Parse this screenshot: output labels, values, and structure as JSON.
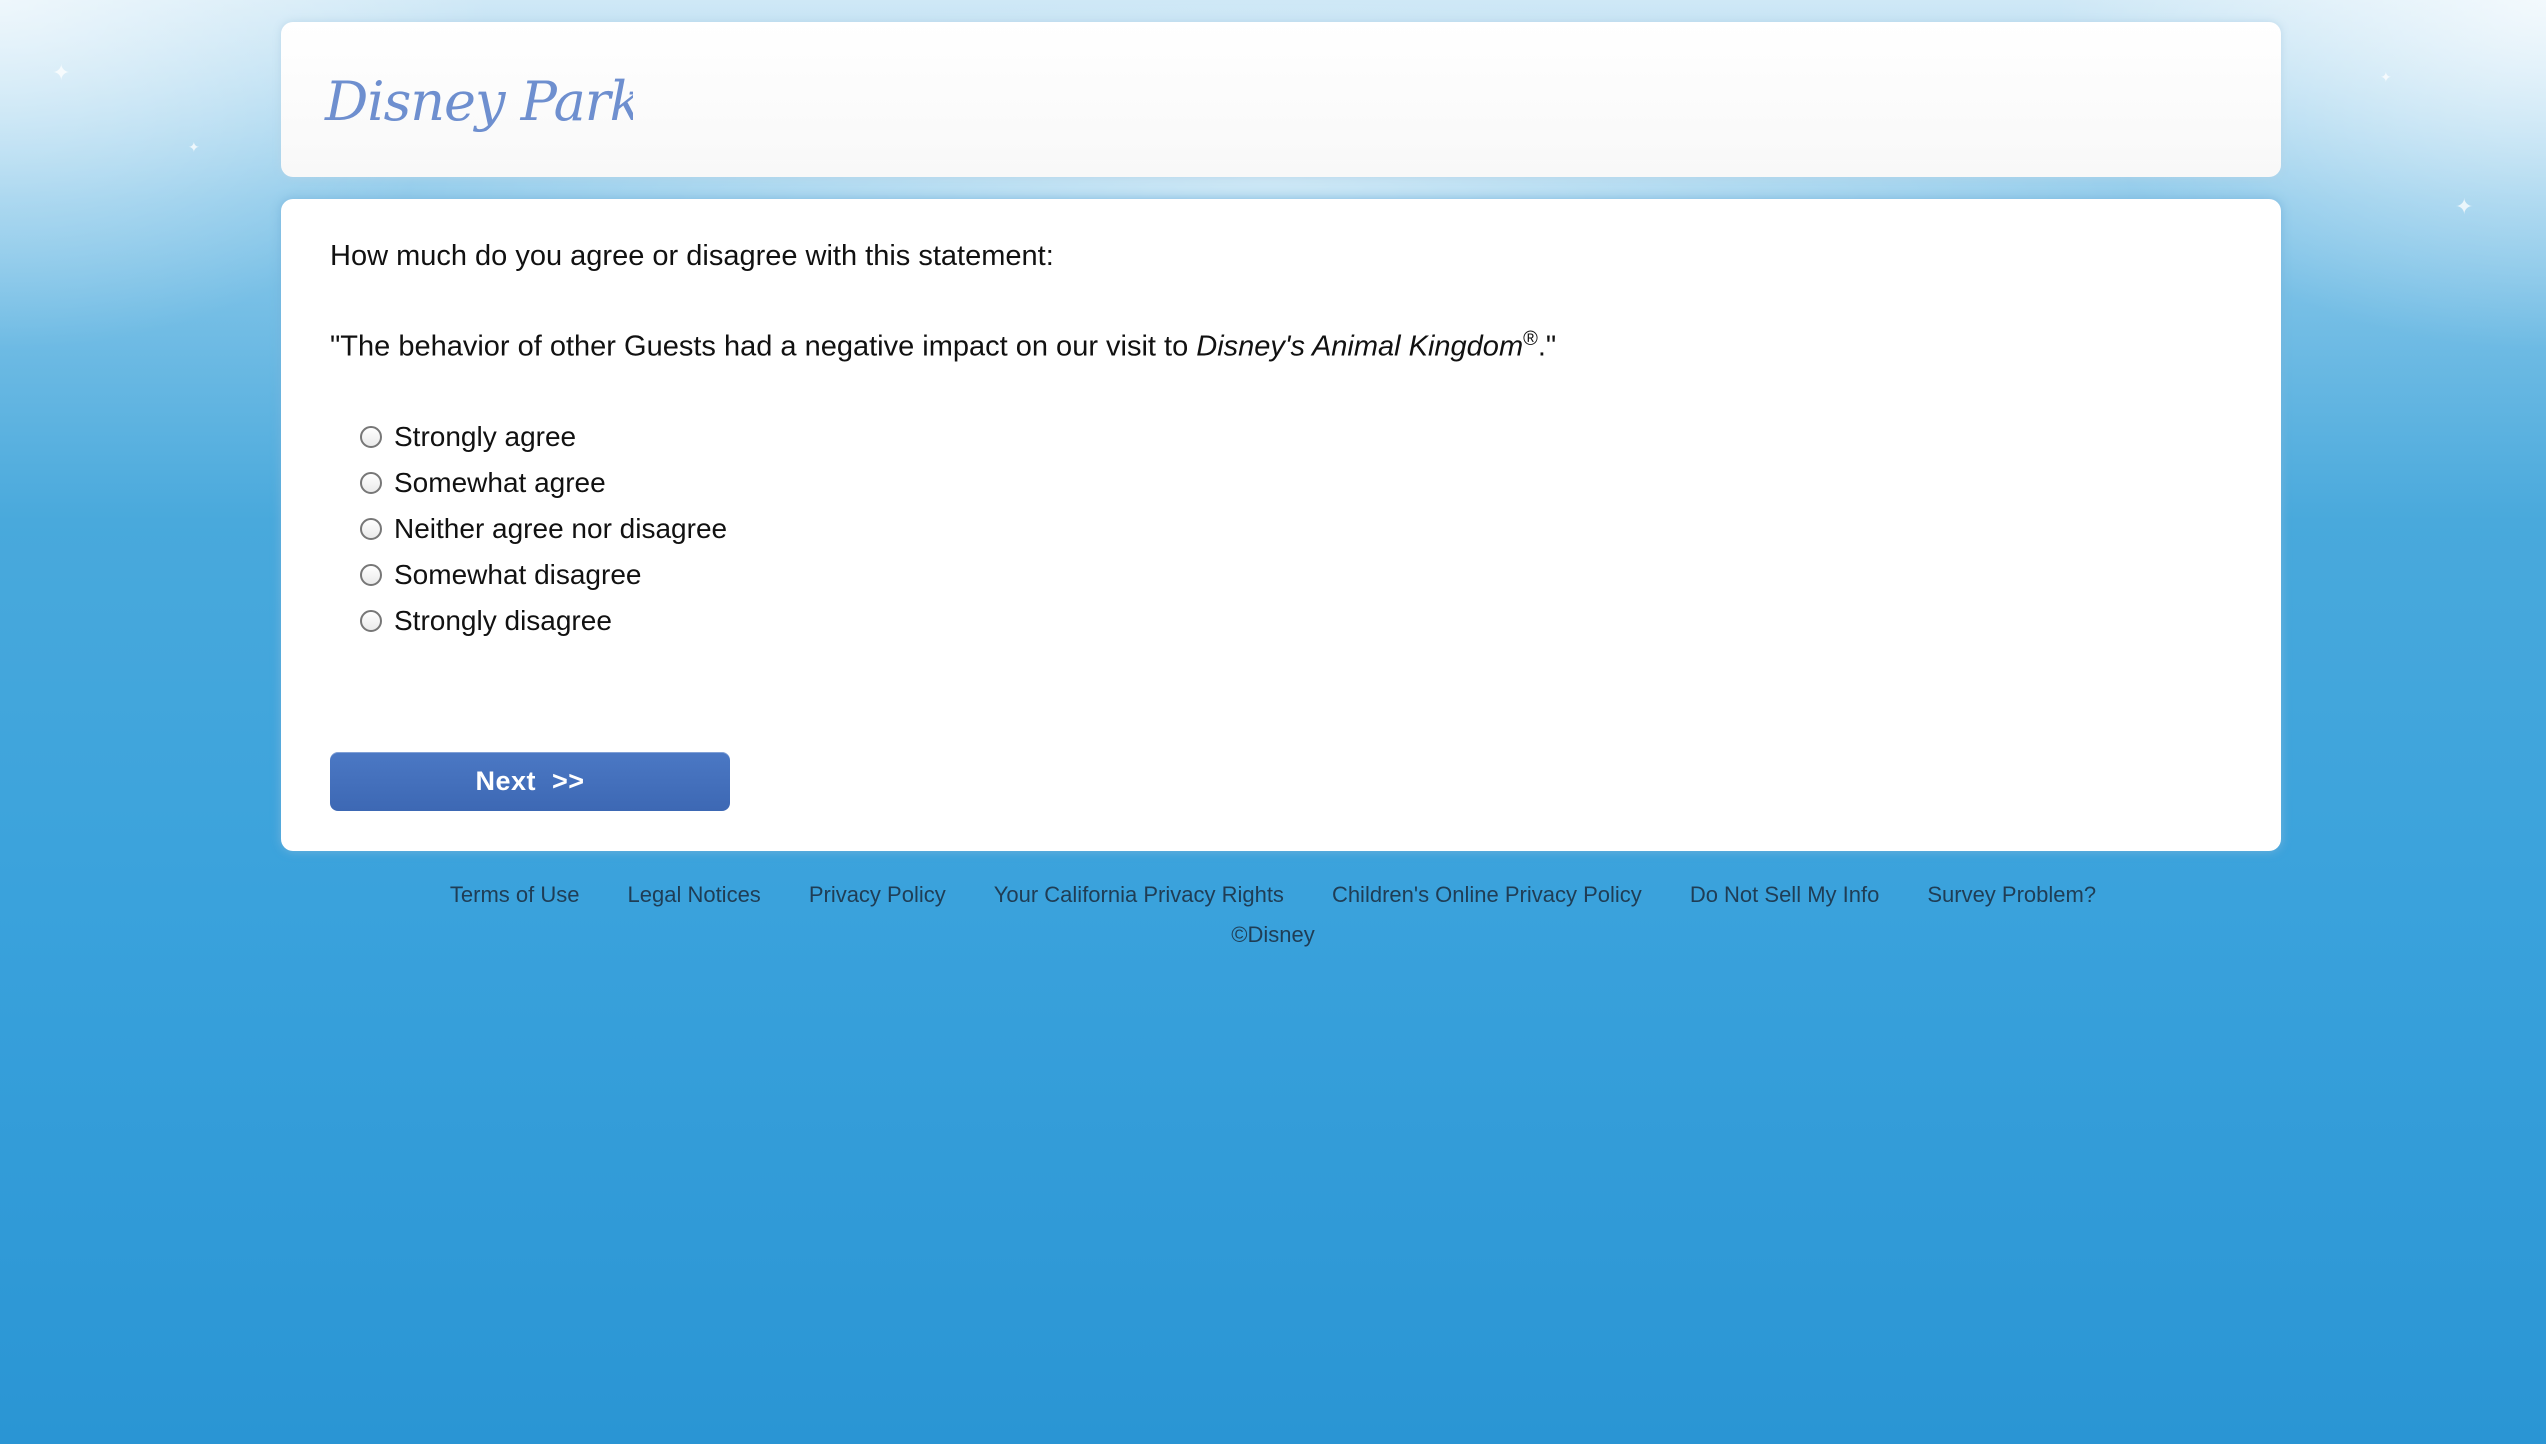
{
  "header": {
    "logo_text": "Disney Parks"
  },
  "survey": {
    "question": "How much do you agree or disagree with this statement:",
    "statement_prefix": "\"The behavior of other Guests had a negative impact on our visit to ",
    "statement_emphasis": "Disney's Animal Kingdom",
    "statement_mark": "®",
    "statement_suffix": ".\"",
    "options": [
      "Strongly agree",
      "Somewhat agree",
      "Neither agree nor disagree",
      "Somewhat disagree",
      "Strongly disagree"
    ],
    "next_label": "Next  >>"
  },
  "footer": {
    "links": [
      "Terms of Use",
      "Legal Notices",
      "Privacy Policy",
      "Your California Privacy Rights",
      "Children's Online Privacy Policy",
      "Do Not Sell My Info",
      "Survey Problem?"
    ],
    "copyright": "©Disney"
  },
  "colors": {
    "brand_blue": "#4b78c4",
    "logo_blue": "#6e8fcf",
    "background_blue": "#2a95d4"
  }
}
